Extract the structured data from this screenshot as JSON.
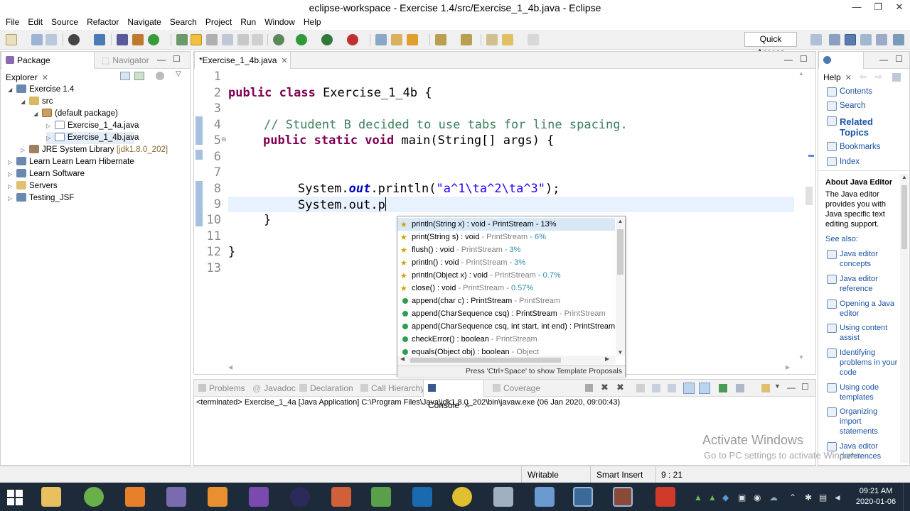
{
  "window": {
    "title": "eclipse-workspace - Exercise 1.4/src/Exercise_1_4b.java - Eclipse"
  },
  "menu": [
    "File",
    "Edit",
    "Source",
    "Refactor",
    "Navigate",
    "Search",
    "Project",
    "Run",
    "Window",
    "Help"
  ],
  "toolbar": {
    "quick_access": "Quick Access"
  },
  "package_explorer": {
    "tabs": [
      "Package Explorer",
      "Navigator"
    ],
    "tree": [
      {
        "label": "Exercise 1.4",
        "indent": 0,
        "icon": "project-icon"
      },
      {
        "label": "src",
        "indent": 1,
        "icon": "src-folder-icon"
      },
      {
        "label": "(default package)",
        "indent": 2,
        "icon": "package-icon"
      },
      {
        "label": "Exercise_1_4a.java",
        "indent": 3,
        "icon": "java-file-icon"
      },
      {
        "label": "Exercise_1_4b.java",
        "indent": 3,
        "icon": "java-file-icon"
      },
      {
        "label": "JRE System Library",
        "suffix": "[jdk1.8.0_202]",
        "indent": 1,
        "icon": "library-icon"
      },
      {
        "label": "Learn Learn Learn Hibernate",
        "indent": 0,
        "icon": "project-icon"
      },
      {
        "label": "Learn Software",
        "indent": 0,
        "icon": "project-icon"
      },
      {
        "label": "Servers",
        "indent": 0,
        "icon": "folder-icon"
      },
      {
        "label": "Testing_JSF",
        "indent": 0,
        "icon": "project-icon"
      }
    ]
  },
  "editor": {
    "tab": "*Exercise_1_4b.java",
    "line_numbers": [
      "1",
      "2",
      "3",
      "4",
      "5",
      "6",
      "7",
      "8",
      "9",
      "10",
      "11",
      "12",
      "13"
    ],
    "lines": {
      "l2_kw": "public class",
      "l2_rest": " Exercise_1_4b {",
      "l4": "// Student B decided to use tabs for line spacing.",
      "l5_kw": "public static void",
      "l5_rest": " main(String[] args) {",
      "l8_a": "System.",
      "l8_b": "out",
      "l8_c": ".println(",
      "l8_d": "\"a^1\\ta^2\\ta^3\"",
      "l8_e": ");",
      "l9": "System.out.p",
      "l10": "}",
      "l12": "}"
    }
  },
  "completion": {
    "items": [
      {
        "main": "println(String x) : void",
        "qual": " - PrintStream - 13%",
        "icon": "star"
      },
      {
        "main": "print(String s) : void",
        "qual": " - PrintStream",
        "pct": " - 6%",
        "icon": "star"
      },
      {
        "main": "flush() : void",
        "qual": " - PrintStream",
        "pct": " - 3%",
        "icon": "star"
      },
      {
        "main": "println() : void",
        "qual": " - PrintStream",
        "pct": " - 3%",
        "icon": "star"
      },
      {
        "main": "println(Object x) : void",
        "qual": " - PrintStream",
        "pct": " - 0.7%",
        "icon": "star"
      },
      {
        "main": "close() : void",
        "qual": " - PrintStream",
        "pct": " - 0.57%",
        "icon": "star"
      },
      {
        "main": "append(char c) : PrintStream",
        "qual": " - PrintStream",
        "icon": "dot"
      },
      {
        "main": "append(CharSequence csq) : PrintStream",
        "qual": " - PrintStream",
        "icon": "dot"
      },
      {
        "main": "append(CharSequence csq, int start, int end) : PrintStream",
        "qual": "",
        "icon": "dot"
      },
      {
        "main": "checkError() : boolean",
        "qual": " - PrintStream",
        "icon": "dot"
      },
      {
        "main": "equals(Object obj) : boolean",
        "qual": " - Object",
        "icon": "dot"
      }
    ],
    "footer": "Press 'Ctrl+Space' to show Template Proposals"
  },
  "console": {
    "tabs": [
      "Problems",
      "Javadoc",
      "Declaration",
      "Call Hierarchy",
      "Console",
      "Coverage"
    ],
    "header": "<terminated> Exercise_1_4a [Java Application] C:\\Program Files\\Java\\jdk1.8.0_202\\bin\\javaw.exe (06 Jan 2020, 09:00:43)"
  },
  "help": {
    "tab": "Help",
    "links": [
      "Contents",
      "Search",
      "Related Topics",
      "Bookmarks",
      "Index"
    ],
    "about_title": "About Java Editor",
    "about_text": "The Java editor provides you with Java specific text editing support.",
    "see_also": "See also:",
    "see_links": [
      "Java editor concepts",
      "Java editor reference",
      "Opening a Java editor",
      "Using content assist",
      "Identifying problems in your code",
      "Using code templates",
      "Organizing import statements",
      "Java editor preferences"
    ]
  },
  "status": {
    "writable": "Writable",
    "insert": "Smart Insert",
    "position": "9 : 21"
  },
  "watermark": {
    "line1": "Activate Windows",
    "line2": "Go to PC settings to activate Windows."
  },
  "taskbar": {
    "time": "09:21 AM",
    "date": "2020-01-06"
  }
}
